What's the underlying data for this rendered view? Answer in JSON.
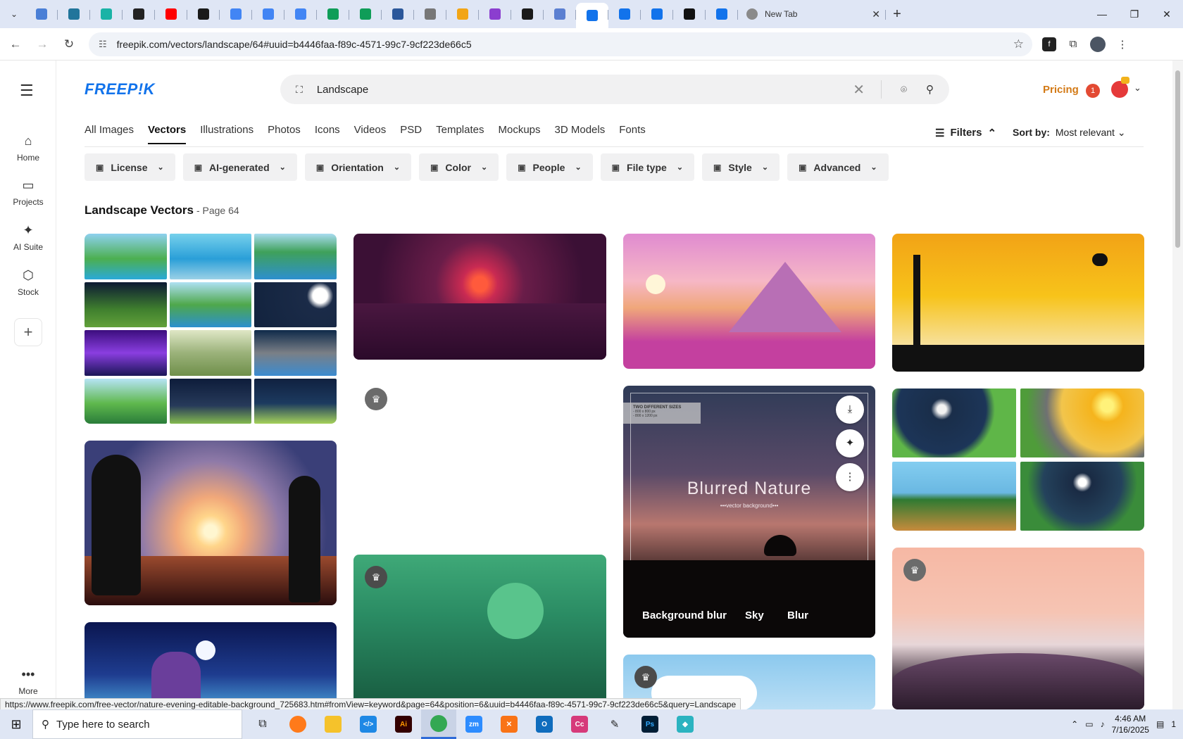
{
  "browser": {
    "tabs": [
      {
        "icon": "globe-icon",
        "color": "#4a7fd6"
      },
      {
        "icon": "wordpress-icon",
        "color": "#21759b"
      },
      {
        "icon": "play-icon",
        "color": "#1ab3a6"
      },
      {
        "icon": "openai-icon",
        "color": "#222222"
      },
      {
        "icon": "youtube-icon",
        "color": "#ff0000"
      },
      {
        "icon": "bolt-icon",
        "color": "#1a1a1a"
      },
      {
        "icon": "docs-icon",
        "color": "#4285f4"
      },
      {
        "icon": "docs-icon",
        "color": "#4285f4"
      },
      {
        "icon": "docs-icon",
        "color": "#4285f4"
      },
      {
        "icon": "sheets-icon",
        "color": "#0f9d58"
      },
      {
        "icon": "sheets-icon",
        "color": "#0f9d58"
      },
      {
        "icon": "word-icon",
        "color": "#2b579a"
      },
      {
        "icon": "globe-icon",
        "color": "#777777"
      },
      {
        "icon": "tool-icon",
        "color": "#f2a516"
      },
      {
        "icon": "code-icon",
        "color": "#8b3ecf"
      },
      {
        "icon": "ai-icon",
        "color": "#1a1a1a"
      },
      {
        "icon": "grid-icon",
        "color": "#5b7fd1"
      },
      {
        "icon": "freepik-icon",
        "color": "#1273eb"
      },
      {
        "icon": "freepik-icon",
        "color": "#1273eb"
      },
      {
        "icon": "freepik-icon",
        "color": "#1273eb"
      },
      {
        "icon": "medium-icon",
        "color": "#111111"
      },
      {
        "icon": "freepik-icon",
        "color": "#1273eb"
      }
    ],
    "new_tab_label": "New Tab",
    "url": "freepik.com/vectors/landscape/64#uuid=b4446faa-f89c-4571-99c7-9cf223de66c5"
  },
  "rail": {
    "items": [
      {
        "label": "Home",
        "icon": "home-icon"
      },
      {
        "label": "Projects",
        "icon": "projects-icon"
      },
      {
        "label": "AI Suite",
        "icon": "sparkle-icon"
      },
      {
        "label": "Stock",
        "icon": "stock-icon"
      }
    ],
    "more_label": "More"
  },
  "header": {
    "logo": "FREEP!K",
    "search_value": "Landscape",
    "pricing_label": "Pricing",
    "notification_count": "1"
  },
  "categories": [
    "All Images",
    "Vectors",
    "Illustrations",
    "Photos",
    "Icons",
    "Videos",
    "PSD",
    "Templates",
    "Mockups",
    "3D Models",
    "Fonts"
  ],
  "active_category": "Vectors",
  "filters_label": "Filters",
  "sort": {
    "label": "Sort by:",
    "value": "Most relevant"
  },
  "chips": [
    {
      "label": "License",
      "icon": "license-icon"
    },
    {
      "label": "AI-generated",
      "icon": "ai-icon"
    },
    {
      "label": "Orientation",
      "icon": "orientation-icon"
    },
    {
      "label": "Color",
      "icon": "palette-icon"
    },
    {
      "label": "People",
      "icon": "people-icon"
    },
    {
      "label": "File type",
      "icon": "file-icon"
    },
    {
      "label": "Style",
      "icon": "brush-icon"
    },
    {
      "label": "Advanced",
      "icon": "gear-icon"
    }
  ],
  "results": {
    "title": "Landscape Vectors",
    "page": "- Page 64"
  },
  "hover_card": {
    "badge_text": "TWO DIFFERENT SIZES",
    "badge_sub1": "- 800 x 800 px",
    "badge_sub2": "- 800 x 1200 px",
    "title": "Blurred Nature",
    "subtitle": "•••vector background•••",
    "tags": [
      "Background blur",
      "Sky",
      "Blur"
    ]
  },
  "status_url": "https://www.freepik.com/free-vector/nature-evening-editable-background_725683.htm#fromView=keyword&page=64&position=6&uuid=b4446faa-f89c-4571-99c7-9cf223de66c5&query=Landscape",
  "taskbar": {
    "search_placeholder": "Type here to search",
    "time": "4:46 AM",
    "date": "7/16/2025",
    "notification_count": "1"
  }
}
